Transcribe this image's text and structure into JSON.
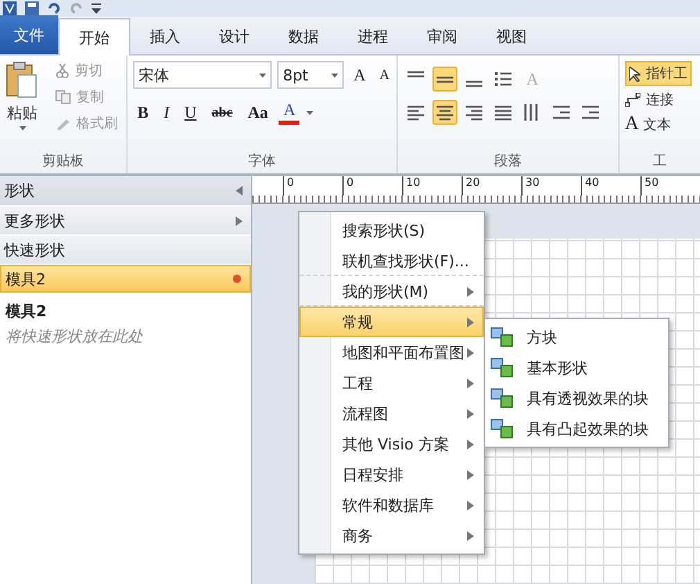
{
  "tabs": [
    {
      "label": "文件",
      "kind": "file",
      "selected": false
    },
    {
      "label": "开始",
      "kind": "normal",
      "selected": true
    },
    {
      "label": "插入",
      "kind": "normal",
      "selected": false
    },
    {
      "label": "设计",
      "kind": "normal",
      "selected": false
    },
    {
      "label": "数据",
      "kind": "normal",
      "selected": false
    },
    {
      "label": "进程",
      "kind": "normal",
      "selected": false
    },
    {
      "label": "审阅",
      "kind": "normal",
      "selected": false
    },
    {
      "label": "视图",
      "kind": "normal",
      "selected": false
    }
  ],
  "clipboard": {
    "paste": "粘贴",
    "cut": "剪切",
    "copy": "复制",
    "format_painter": "格式刷",
    "label": "剪贴板"
  },
  "font": {
    "font_name": "宋体",
    "font_size": "8pt",
    "grow": "A",
    "shrink": "A",
    "bold": "B",
    "italic": "I",
    "underline": "U",
    "strikethrough": "abc",
    "change_case": "Aa",
    "font_color": "A",
    "label": "字体"
  },
  "paragraph": {
    "label": "段落",
    "buttons": [
      {
        "kind": "align-top",
        "selected": false
      },
      {
        "kind": "align-middle",
        "selected": true
      },
      {
        "kind": "align-bottom",
        "selected": false
      },
      {
        "kind": "bullets",
        "selected": false
      },
      {
        "kind": "text-size",
        "glyph": "A",
        "selected": false
      },
      {
        "kind": "align-left",
        "selected": false
      },
      {
        "kind": "align-center",
        "selected": true
      },
      {
        "kind": "align-right",
        "selected": false
      },
      {
        "kind": "justify",
        "selected": false
      },
      {
        "kind": "vertical-text",
        "selected": false
      },
      {
        "kind": "outdent",
        "selected": false
      },
      {
        "kind": "indent",
        "selected": false
      }
    ]
  },
  "tools": {
    "pointer": "指针工",
    "connector": "连接",
    "text_glyph": "A",
    "text": "文本",
    "label": "工"
  },
  "shapes_pane": {
    "title": "形状",
    "items": [
      {
        "label": "更多形状",
        "kind": "submenu",
        "selected": false
      },
      {
        "label": "快速形状",
        "kind": "plain",
        "selected": false
      },
      {
        "label": "模具2",
        "kind": "stencil",
        "selected": true
      }
    ],
    "stencil_title": "模具2",
    "stencil_hint": "将快速形状放在此处"
  },
  "ruler": [
    "0",
    "0",
    "10",
    "20",
    "30",
    "40",
    "50"
  ],
  "menu": [
    {
      "label": "搜索形状(S)",
      "submenu": false,
      "selected": false,
      "divider_after": false
    },
    {
      "label": "联机查找形状(F)...",
      "submenu": false,
      "selected": false,
      "divider_after": true
    },
    {
      "label": "我的形状(M)",
      "submenu": true,
      "selected": false,
      "divider_after": true
    },
    {
      "label": "常规",
      "submenu": true,
      "selected": true,
      "divider_after": false
    },
    {
      "label": "地图和平面布置图",
      "submenu": true,
      "selected": false,
      "divider_after": false
    },
    {
      "label": "工程",
      "submenu": true,
      "selected": false,
      "divider_after": false
    },
    {
      "label": "流程图",
      "submenu": true,
      "selected": false,
      "divider_after": false
    },
    {
      "label": "其他 Visio 方案",
      "submenu": true,
      "selected": false,
      "divider_after": false
    },
    {
      "label": "日程安排",
      "submenu": true,
      "selected": false,
      "divider_after": false
    },
    {
      "label": "软件和数据库",
      "submenu": true,
      "selected": false,
      "divider_after": false
    },
    {
      "label": "商务",
      "submenu": true,
      "selected": false,
      "divider_after": false
    }
  ],
  "submenu": [
    "方块",
    "基本形状",
    "具有透视效果的块",
    "具有凸起效果的块"
  ]
}
